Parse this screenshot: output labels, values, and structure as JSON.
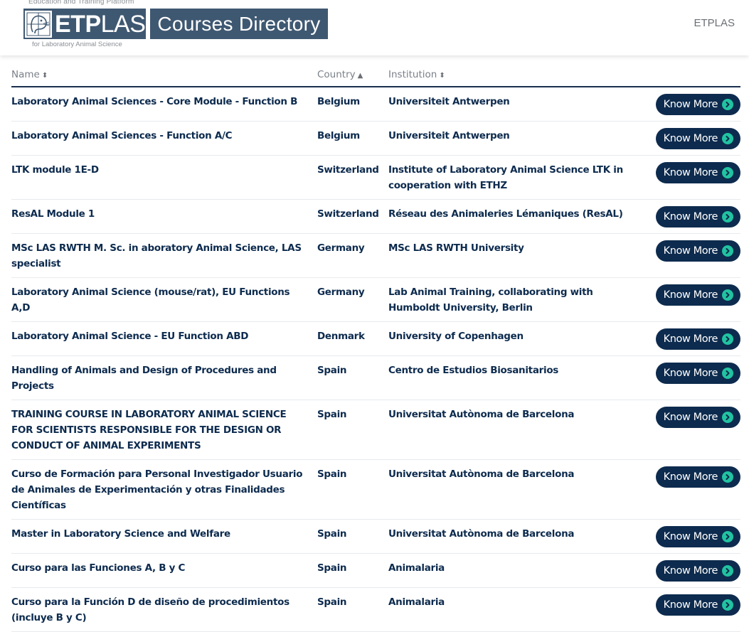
{
  "header": {
    "tagline_top": "Education and Training Platform",
    "tagline_bottom": "for Laboratory Animal Science",
    "logo_bold": "ETP",
    "logo_light": "LAS",
    "page_title": "Courses Directory",
    "nav_link": "ETPLAS",
    "logo_icon": "mouse-icon"
  },
  "table": {
    "columns": [
      {
        "label": "Name",
        "sort": "sort-both-icon",
        "sort_glyph": "⬍"
      },
      {
        "label": "Country",
        "sort": "sort-asc-icon",
        "sort_glyph": "▲"
      },
      {
        "label": "Institution",
        "sort": "sort-both-icon",
        "sort_glyph": "⬍"
      }
    ],
    "button_label": "Know More",
    "button_icon": "chevron-right-circle-icon",
    "rows": [
      {
        "name": "Laboratory Animal Sciences - Core Module - Function B",
        "country": "Belgium",
        "institution": "Universiteit Antwerpen"
      },
      {
        "name": "Laboratory Animal Sciences - Function A/C",
        "country": "Belgium",
        "institution": "Universiteit Antwerpen"
      },
      {
        "name": "LTK module 1E-D",
        "country": "Switzerland",
        "institution": "Institute of Laboratory Animal Science LTK in cooperation with ETHZ"
      },
      {
        "name": "ResAL Module 1",
        "country": "Switzerland",
        "institution": "Réseau des Animaleries Lémaniques (ResAL)"
      },
      {
        "name": "MSc LAS RWTH M. Sc. in aboratory Animal Science, LAS specialist",
        "country": "Germany",
        "institution": "MSc LAS RWTH University"
      },
      {
        "name": "Laboratory Animal Science (mouse/rat), EU Functions A,D",
        "country": "Germany",
        "institution": "Lab Animal Training, collaborating with Humboldt University, Berlin"
      },
      {
        "name": "Laboratory Animal Science - EU Function ABD",
        "country": "Denmark",
        "institution": "University of Copenhagen"
      },
      {
        "name": "Handling of Animals and Design of Procedures and Projects",
        "country": "Spain",
        "institution": "Centro de Estudios Biosanitarios"
      },
      {
        "name": "TRAINING COURSE IN LABORATORY ANIMAL SCIENCE FOR SCIENTISTS RESPONSIBLE FOR THE DESIGN OR CONDUCT OF ANIMAL EXPERIMENTS",
        "country": "Spain",
        "institution": "Universitat Autònoma de Barcelona"
      },
      {
        "name": "Curso de Formación para Personal Investigador Usuario de Animales de Experimentación y otras Finalidades Científicas",
        "country": "Spain",
        "institution": "Universitat Autònoma de Barcelona"
      },
      {
        "name": "Master in Laboratory Science and Welfare",
        "country": "Spain",
        "institution": "Universitat Autònoma de Barcelona"
      },
      {
        "name": "Curso para las Funciones A, B y C",
        "country": "Spain",
        "institution": "Animalaria"
      },
      {
        "name": "Curso para la Función D de diseño de procedimientos (incluye B y C)",
        "country": "Spain",
        "institution": "Animalaria"
      }
    ]
  },
  "colors": {
    "brand_navy": "#0d2b4e",
    "logo_slate": "#3f5872",
    "accent_teal": "#21c3a1"
  }
}
